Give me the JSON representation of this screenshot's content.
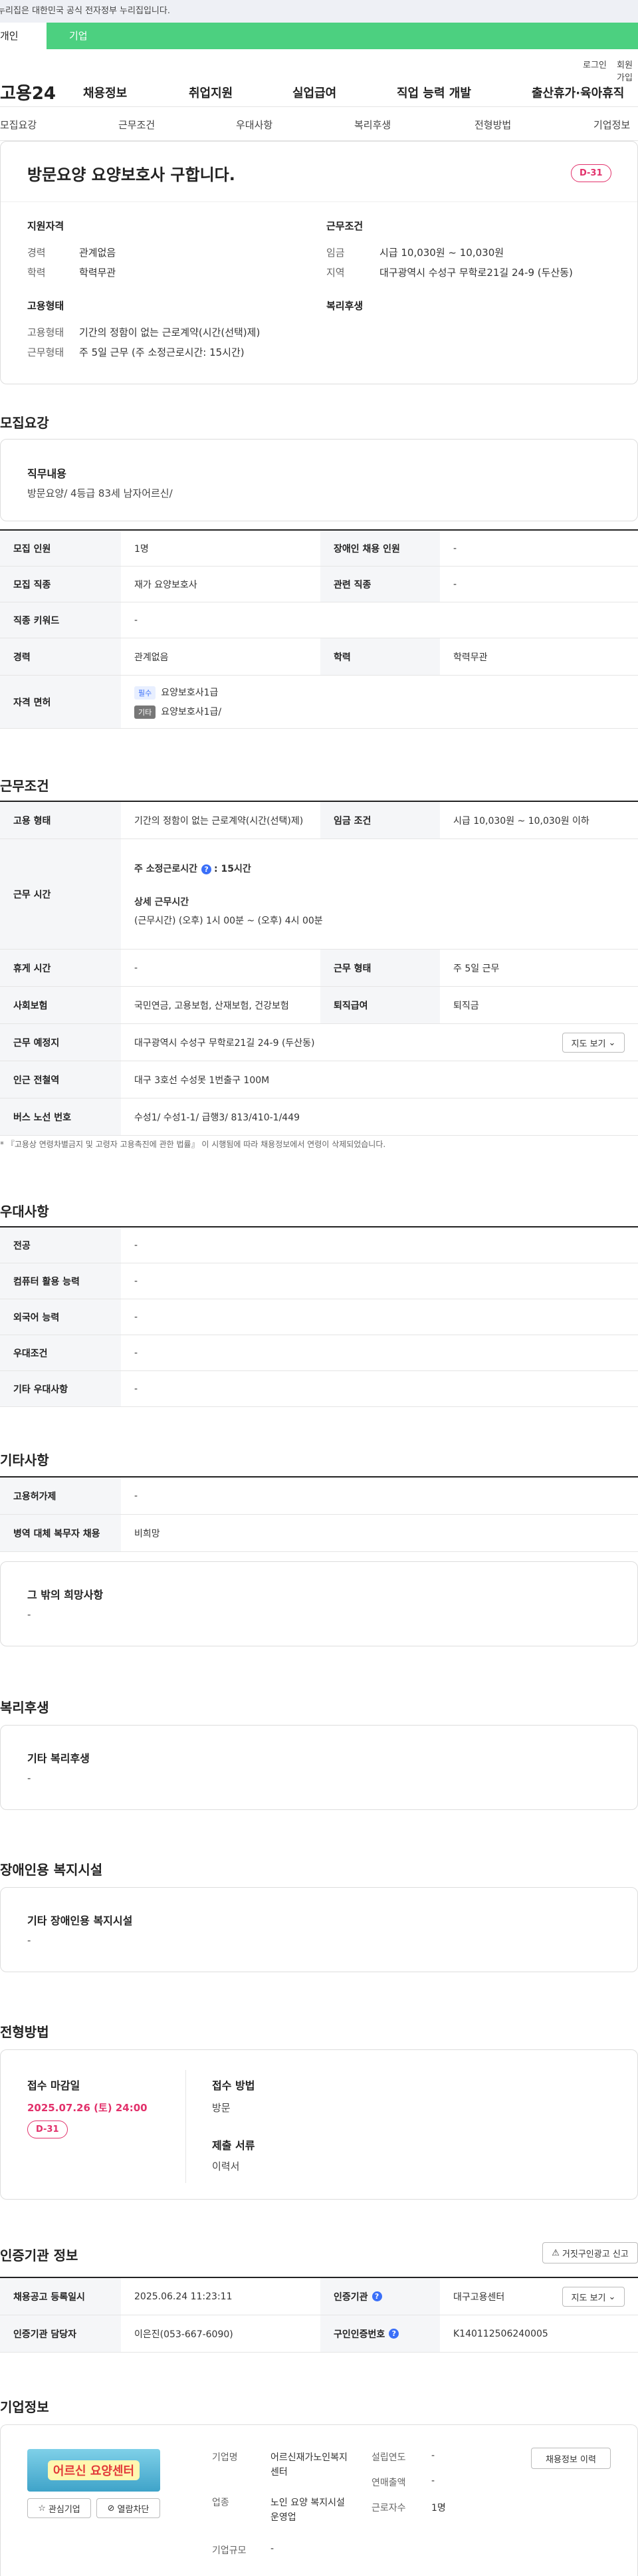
{
  "gov_banner": "이 누리집은 대한민국 공식 전자정부 누리집입니다.",
  "tabs": [
    "개인",
    "기업"
  ],
  "util": {
    "login": "로그인",
    "join": "회원가입"
  },
  "logo": "고용24",
  "gnb": [
    "채용정보",
    "취업지원",
    "실업급여",
    "직업 능력 개발",
    "출산휴가·육아휴직"
  ],
  "lnb": [
    "모집요강",
    "근무조건",
    "우대사항",
    "복리후생",
    "전형방법",
    "기업정보"
  ],
  "summary": {
    "title": "방문요양 요양보호사 구합니다.",
    "dday": "D-31",
    "qual_title": "지원자격",
    "career_label": "경력",
    "career_value": "관계없음",
    "edu_label": "학력",
    "edu_value": "학력무관",
    "cond_title": "근무조건",
    "wage_label": "임금",
    "wage_value": "시급 10,030원 ~ 10,030원",
    "area_label": "지역",
    "area_value": "대구광역시 수성구 무학로21길 24-9 (두산동)",
    "emp_title": "고용형태",
    "emp_type_label": "고용형태",
    "emp_type_value": "기간의 정함이 없는 근로계약(시간(선택)제)",
    "work_type_label": "근무형태",
    "work_type_value": "주 5일 근무 (주 소정근로시간: 15시간)",
    "welfare_title": "복리후생"
  },
  "recruit": {
    "title": "모집요강",
    "duty_title": "직무내용",
    "duty_value": "방문요양/ 4등급 83세 남자어르신/",
    "rows": {
      "people_h": "모집 인원",
      "people_v": "1명",
      "disabled_h": "장애인 채용 인원",
      "disabled_v": "-",
      "job_h": "모집 직종",
      "job_v": "재가 요양보호사",
      "related_h": "관련 직종",
      "related_v": "-",
      "keyword_h": "직종 키워드",
      "keyword_v": "-",
      "career_h": "경력",
      "career_v": "관계없음",
      "edu_h": "학력",
      "edu_v": "학력무관",
      "license_h": "자격 면허",
      "license_1_badge": "필수",
      "license_1": "요양보호사1급",
      "license_2_badge": "기타",
      "license_2": "요양보호사1급/"
    }
  },
  "conditions": {
    "title": "근무조건",
    "emp_h": "고용 형태",
    "emp_v": "기간의 정함이 없는 근로계약(시간(선택)제)",
    "wage_h": "임금 조건",
    "wage_v": "시급 10,030원 ~ 10,030원 이하",
    "hours_h": "근무 시간",
    "hours_weekly_label": "주 소정근로시간",
    "hours_weekly_value": ": 15시간",
    "hours_detail_label": "상세 근무시간",
    "hours_detail_value": "(근무시간) (오후) 1시 00분 ~ (오후) 4시 00분",
    "rest_h": "휴게 시간",
    "rest_v": "-",
    "worktype_h": "근무 형태",
    "worktype_v": "주 5일 근무",
    "insurance_h": "사회보험",
    "insurance_v": "국민연금, 고용보험, 산재보험, 건강보험",
    "retire_h": "퇴직급여",
    "retire_v": "퇴직금",
    "place_h": "근무 예정지",
    "place_v": "대구광역시 수성구 무학로21길 24-9 (두산동)",
    "map_btn": "지도 보기",
    "subway_h": "인근 전철역",
    "subway_v": "대구 3호선 수성못 1번출구 100M",
    "bus_h": "버스 노선 번호",
    "bus_v": "수성1/ 수성1-1/ 급행3/ 813/410-1/449",
    "note": "* 『고용상 연령차별금지 및 고령자 고용촉진에 관한 법률』 이 시행됨에 따라 채용정보에서 연령이 삭제되었습니다."
  },
  "preference": {
    "title": "우대사항",
    "major_h": "전공",
    "major_v": "-",
    "computer_h": "컴퓨터 활용 능력",
    "computer_v": "-",
    "lang_h": "외국어 능력",
    "lang_v": "-",
    "pref_h": "우대조건",
    "pref_v": "-",
    "etc_h": "기타 우대사항",
    "etc_v": "-"
  },
  "etc": {
    "title": "기타사항",
    "ins_h": "고용허가제",
    "ins_v": "-",
    "mil_h": "병역 대체 복무자 채용",
    "mil_v": "비희망",
    "wish_title": "그 밖의 희망사항",
    "wish_v": "-"
  },
  "welfare": {
    "title": "복리후생",
    "sub": "기타 복리후생",
    "value": "-"
  },
  "disabled": {
    "title": "장애인용 복지시설",
    "sub": "기타 장애인용 복지시설",
    "value": "-"
  },
  "selection": {
    "title": "전형방법",
    "deadline_label": "접수 마감일",
    "deadline_value": "2025.07.26 (토) 24:00",
    "dday": "D-31",
    "method_label": "접수 방법",
    "method_value": "방문",
    "docs_label": "제출 서류",
    "docs_value": "이력서"
  },
  "agency": {
    "title": "인증기관 정보",
    "report_btn": "거짓구인광고 신고",
    "reg_h": "채용공고 등록일시",
    "reg_v": "2025.06.24 11:23:11",
    "org_h": "인증기관",
    "org_v": "대구고용센터",
    "map_btn": "지도 보기",
    "mgr_h": "인증기관 담당자",
    "mgr_v": "이은진(053-667-6090)",
    "num_h": "구인인증번호",
    "num_v": "K140112506240005"
  },
  "company": {
    "title": "기업정보",
    "logo_text": "어르신 요양센터",
    "like_btn": "관심기업",
    "block_btn": "열람차단",
    "name_label": "기업명",
    "name_value": "어르신재가노인복지센터",
    "biz_label": "업종",
    "biz_value": "노인 요양 복지시설 운영업",
    "size_label": "기업규모",
    "size_value": "-",
    "founded_label": "설립연도",
    "founded_value": "-",
    "sales_label": "연매출액",
    "sales_value": "-",
    "staff_label": "근로자수",
    "staff_value": "1명",
    "history_btn": "채용정보 이력"
  },
  "colors": {
    "accent_green": "#4cd080",
    "dday_pink": "#e2316b",
    "info_blue": "#3a6ff8"
  }
}
